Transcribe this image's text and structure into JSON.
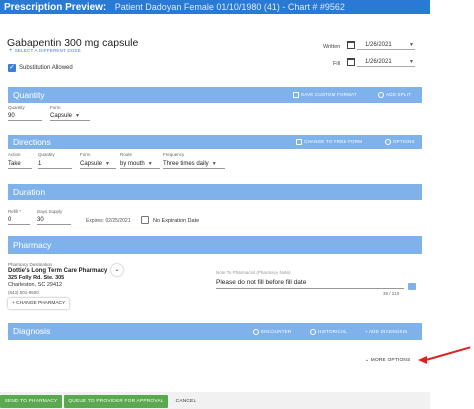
{
  "header": {
    "title": "Prescription Preview:",
    "patient_info": "Patient Dadoyan Female 01/10/1980 (41) - Chart # #9562"
  },
  "medication": {
    "name": "Gabapentin 300 mg capsule",
    "select_different": "SELECT A DIFFERENT DOSE",
    "substitution_label": "Substitution Allowed",
    "substitution_checked": true
  },
  "dates": {
    "written_label": "Written",
    "written_value": "1/26/2021",
    "fill_label": "Fill",
    "fill_value": "1/26/2021"
  },
  "quantity": {
    "section_title": "Quantity",
    "save_custom_format": "SAVE CUSTOM FORMAT",
    "add_split": "ADD SPLIT",
    "quantity_label": "Quantity",
    "quantity_value": "90",
    "form_label": "Form",
    "form_value": "Capsule"
  },
  "directions": {
    "section_title": "Directions",
    "change_to_free_form": "CHANGE TO FREE FORM",
    "options": "OPTIONS",
    "action_label": "Action",
    "action_value": "Take",
    "quantity_label": "Quantity",
    "quantity_value": "1",
    "form_label": "Form",
    "form_value": "Capsule",
    "route_label": "Route",
    "route_value": "by mouth",
    "frequency_label": "Frequency",
    "frequency_value": "Three times daily"
  },
  "duration": {
    "section_title": "Duration",
    "refill_label": "Refill *",
    "refill_value": "0",
    "days_supply_label": "Days Supply",
    "days_supply_value": "30",
    "expires_text": "Expires: 02/25/2021",
    "no_expiration_label": "No Expiration Date"
  },
  "pharmacy": {
    "section_title": "Pharmacy",
    "destination_label": "Pharmacy Destination",
    "name": "Dottie's Long Term Care Pharmacy",
    "address_line1": "325 Folly Rd. Ste. 305",
    "address_line2": "Charleston, SC 29412",
    "phone": "(843) 501-9500",
    "change_button": "CHANGE PHARMACY",
    "note_label": "Note To Pharmacist (Pharmacy Note)",
    "note_value": "Please do not fill before fill date",
    "note_counter": "35 / 210"
  },
  "diagnosis": {
    "section_title": "Diagnosis",
    "encounter": "ENCOUNTER",
    "historical": "HISTORICAL",
    "add_diagnosis": "ADD DIAGNOSIS"
  },
  "more_options": "MORE OPTIONS",
  "footer": {
    "send_to_pharmacy": "SEND TO PHARMACY",
    "queue_for_approval": "QUEUE TO PROVIDER FOR APPROVAL",
    "cancel": "CANCEL"
  },
  "colors": {
    "header_blue": "#2979d5",
    "section_blue": "#7fb2eb",
    "button_green": "#5aa84f",
    "annotation_red": "#e02020"
  }
}
